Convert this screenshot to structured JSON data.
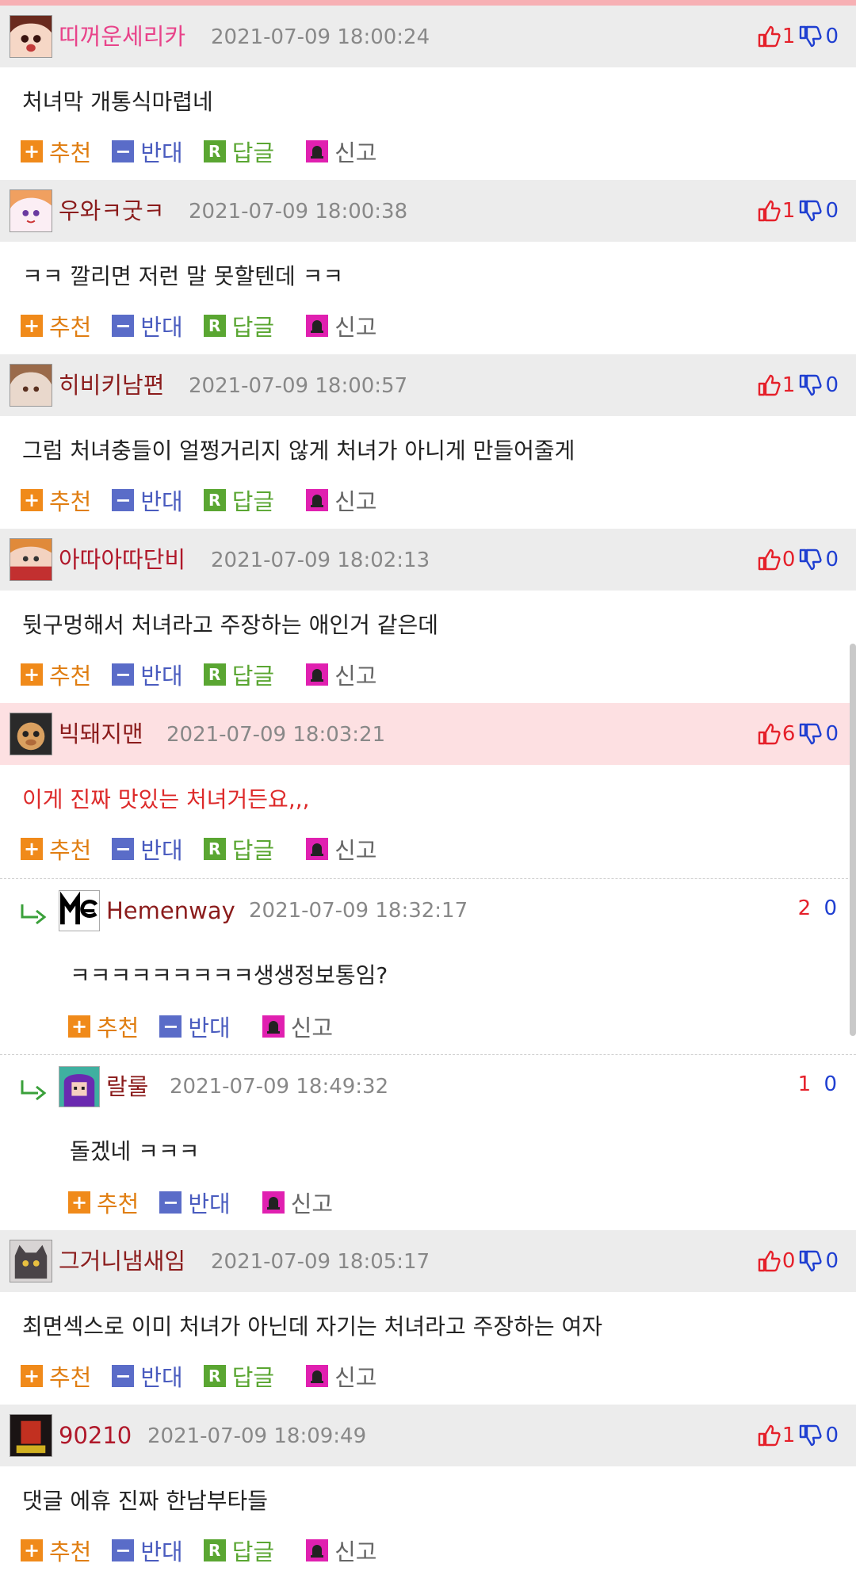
{
  "actions": {
    "recommend": "추천",
    "oppose": "반대",
    "reply": "답글",
    "report": "신고",
    "reply_badge": "R"
  },
  "comments": [
    {
      "nick": "띠꺼운세리카",
      "date": "2021-07-09 18:00:24",
      "up": "1",
      "down": "0",
      "text": "처녀막 개통식마렵네"
    },
    {
      "nick": "우와ㅋ굿ㅋ",
      "date": "2021-07-09 18:00:38",
      "up": "1",
      "down": "0",
      "text": "ㅋㅋ 깔리면 저런 말 못할텐데 ㅋㅋ"
    },
    {
      "nick": "히비키남편",
      "date": "2021-07-09 18:00:57",
      "up": "1",
      "down": "0",
      "text": "그럼 처녀충들이 얼쩡거리지 않게 처녀가 아니게 만들어줄게"
    },
    {
      "nick": "아따아따단비",
      "date": "2021-07-09 18:02:13",
      "up": "0",
      "down": "0",
      "text": "뒷구멍해서 처녀라고 주장하는 애인거 같은데"
    },
    {
      "nick": "빅돼지맨",
      "date": "2021-07-09 18:03:21",
      "up": "6",
      "down": "0",
      "text": "이게 진짜 맛있는 처녀거든요,,,",
      "replies": [
        {
          "nick": "Hemenway",
          "date": "2021-07-09 18:32:17",
          "up": "2",
          "down": "0",
          "text": "ㅋㅋㅋㅋㅋㅋㅋㅋㅋ생생정보통임?"
        },
        {
          "nick": "랄룰",
          "date": "2021-07-09 18:49:32",
          "up": "1",
          "down": "0",
          "text": "돌겠네 ㅋㅋㅋ"
        }
      ]
    },
    {
      "nick": "그거니냄새임",
      "date": "2021-07-09 18:05:17",
      "up": "0",
      "down": "0",
      "text": "최면섹스로 이미 처녀가 아닌데 자기는 처녀라고 주장하는 여자"
    },
    {
      "nick": "90210",
      "date": "2021-07-09 18:09:49",
      "up": "1",
      "down": "0",
      "text": "댓글 에휴 진짜 한남부타들"
    }
  ],
  "colors": {
    "recommend": "#f08a1a",
    "oppose": "#5a6cc8",
    "reply": "#5aa632",
    "report": "#e020b0",
    "upvote": "#e5202a",
    "downvote": "#1f3fd1",
    "highlight": "#fde0e2"
  }
}
